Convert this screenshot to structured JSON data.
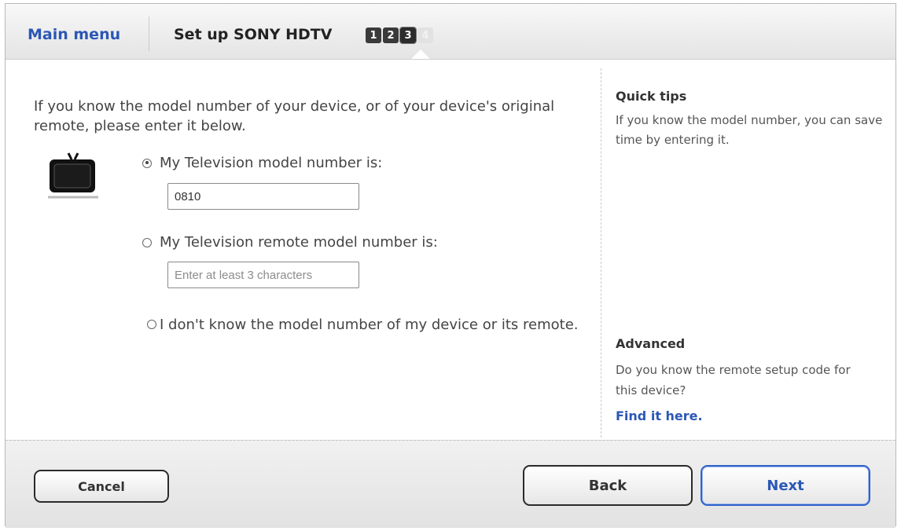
{
  "header": {
    "main_menu": "Main menu",
    "title": "Set up SONY HDTV",
    "steps": [
      "1",
      "2",
      "3",
      "4"
    ]
  },
  "content": {
    "intro": "If you know the model number of your device, or of your device's original remote, please enter it below.",
    "options": {
      "tv_model_label": "My Television model number is:",
      "tv_model_value": "0810",
      "remote_model_label": "My Television remote model number is:",
      "remote_model_placeholder": "Enter at least 3 characters",
      "unknown_label": "I don't know the model number of my device or its remote."
    }
  },
  "sidebar": {
    "quick_tips_title": "Quick tips",
    "quick_tips_text": "If you know the model number, you can save time by entering it.",
    "advanced_title": "Advanced",
    "advanced_text": "Do you know the remote setup code for this device?",
    "advanced_link": "Find it here."
  },
  "footer": {
    "cancel": "Cancel",
    "back": "Back",
    "next": "Next"
  },
  "colors": {
    "link_blue": "#2b57b5",
    "next_border": "#2f63c8"
  },
  "icons": {
    "tv": "television-icon"
  }
}
